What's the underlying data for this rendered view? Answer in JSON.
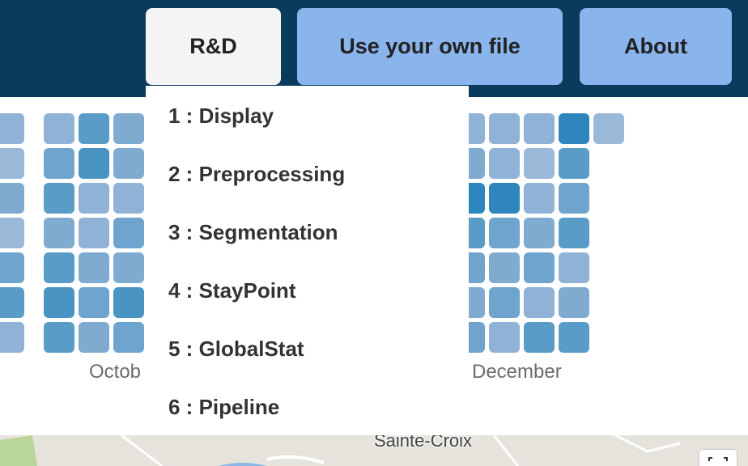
{
  "header": {
    "buttons": [
      {
        "label": "R&D"
      },
      {
        "label": "Use your own file"
      },
      {
        "label": "About"
      }
    ]
  },
  "dropdown": {
    "items": [
      {
        "label": "1 : Display"
      },
      {
        "label": "2 : Preprocessing"
      },
      {
        "label": "3 : Segmentation"
      },
      {
        "label": "4 : StayPoint"
      },
      {
        "label": "5 : GlobalStat"
      },
      {
        "label": "6 : Pipeline"
      }
    ]
  },
  "calendar": {
    "month_labels": [
      "Octob",
      "December"
    ]
  },
  "map": {
    "place_label": "Sainte-Croix"
  },
  "colors": {
    "topbar": "#0a3a5c",
    "button_active": "#f4f4f4",
    "button": "#8ab4ec",
    "cell_palette": [
      "#9ab8d8",
      "#8fb2d6",
      "#7fabd1",
      "#6ea4cd",
      "#5a9cc8",
      "#4a94c4",
      "#2f86bf"
    ]
  }
}
